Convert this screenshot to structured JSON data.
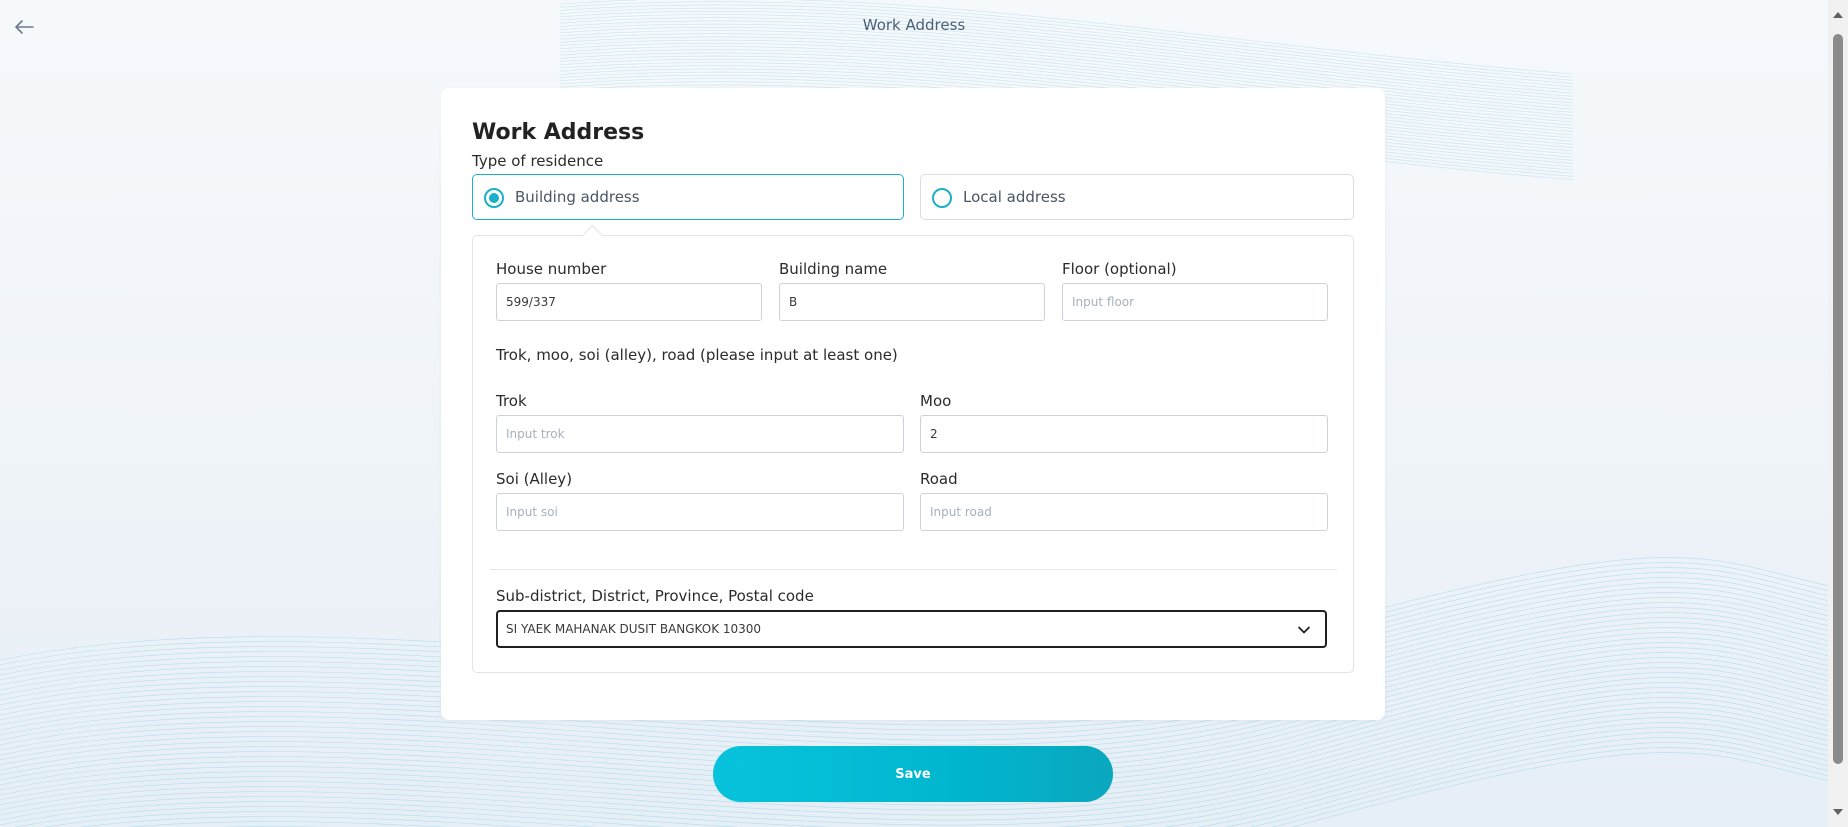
{
  "header": {
    "title": "Work Address"
  },
  "card": {
    "title": "Work Address",
    "residence_label": "Type of residence",
    "options": [
      {
        "label": "Building address",
        "selected": true
      },
      {
        "label": "Local address",
        "selected": false
      }
    ]
  },
  "fields": {
    "house_number": {
      "label": "House number",
      "value": "599/337",
      "placeholder": ""
    },
    "building_name": {
      "label": "Building name",
      "value": "B",
      "placeholder": ""
    },
    "floor": {
      "label": "Floor (optional)",
      "value": "",
      "placeholder": "Input floor"
    },
    "hint": "Trok, moo, soi (alley), road (please input at least one)",
    "trok": {
      "label": "Trok",
      "value": "",
      "placeholder": "Input trok"
    },
    "moo": {
      "label": "Moo",
      "value": "2",
      "placeholder": ""
    },
    "soi": {
      "label": "Soi (Alley)",
      "value": "",
      "placeholder": "Input soi"
    },
    "road": {
      "label": "Road",
      "value": "",
      "placeholder": "Input road"
    },
    "location": {
      "label": "Sub-district, District, Province, Postal code",
      "value": "SI YAEK MAHANAK DUSIT BANGKOK 10300"
    }
  },
  "actions": {
    "save_label": "Save"
  },
  "colors": {
    "accent": "#1ab0c6",
    "save_button": "#00b6cf"
  },
  "icons": {
    "back": "arrow-left-icon",
    "select": "chevron-down-icon"
  }
}
